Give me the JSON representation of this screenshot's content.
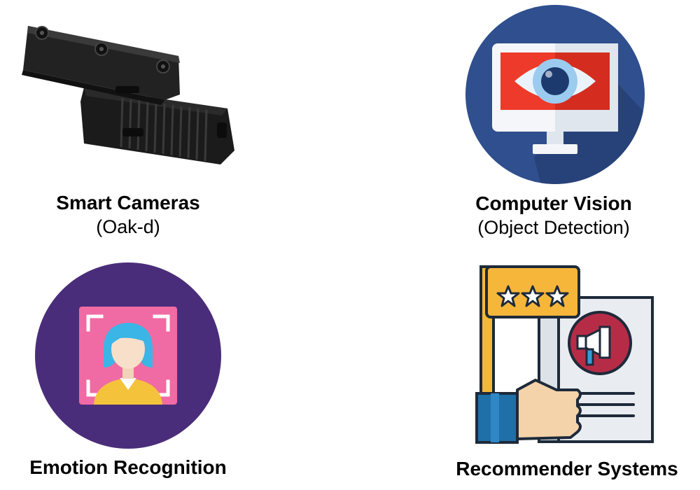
{
  "items": [
    {
      "title": "Smart Cameras",
      "subtitle": "(Oak-d)",
      "icon": "camera-device-icon"
    },
    {
      "title": "Computer Vision",
      "subtitle": "(Object Detection)",
      "icon": "eye-monitor-icon"
    },
    {
      "title": "Emotion Recognition",
      "subtitle": "",
      "icon": "face-scan-icon"
    },
    {
      "title": "Recommender Systems",
      "subtitle": "",
      "icon": "review-rating-icon"
    }
  ],
  "colors": {
    "vision_circle": "#2f4f8e",
    "emotion_circle": "#4a2d7a",
    "monitor_red": "#ee3a2a",
    "rating_orange": "#f6b63a"
  }
}
